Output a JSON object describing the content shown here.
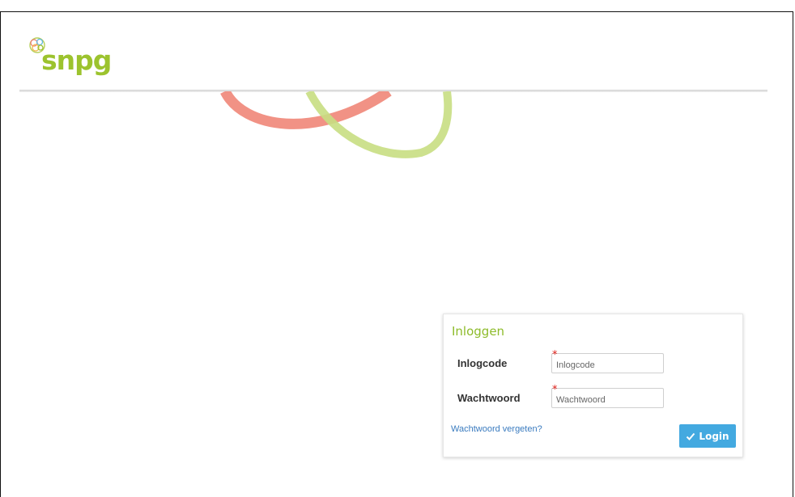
{
  "brand": {
    "name": "snpg",
    "logo_icon": "circle-cluster-icon",
    "brand_color": "#9cc32e",
    "swirl_colors": [
      "#ee7f70",
      "#c8de82"
    ]
  },
  "login": {
    "title": "Inloggen",
    "username_label": "Inlogcode",
    "username_placeholder": "Inlogcode",
    "password_label": "Wachtwoord",
    "password_placeholder": "Wachtwoord",
    "required_marker": "*",
    "forgot_link": "Wachtwoord vergeten?",
    "submit_label": "Login",
    "submit_icon": "check-icon",
    "button_color": "#43a9e0",
    "required_color": "#e0201a"
  }
}
